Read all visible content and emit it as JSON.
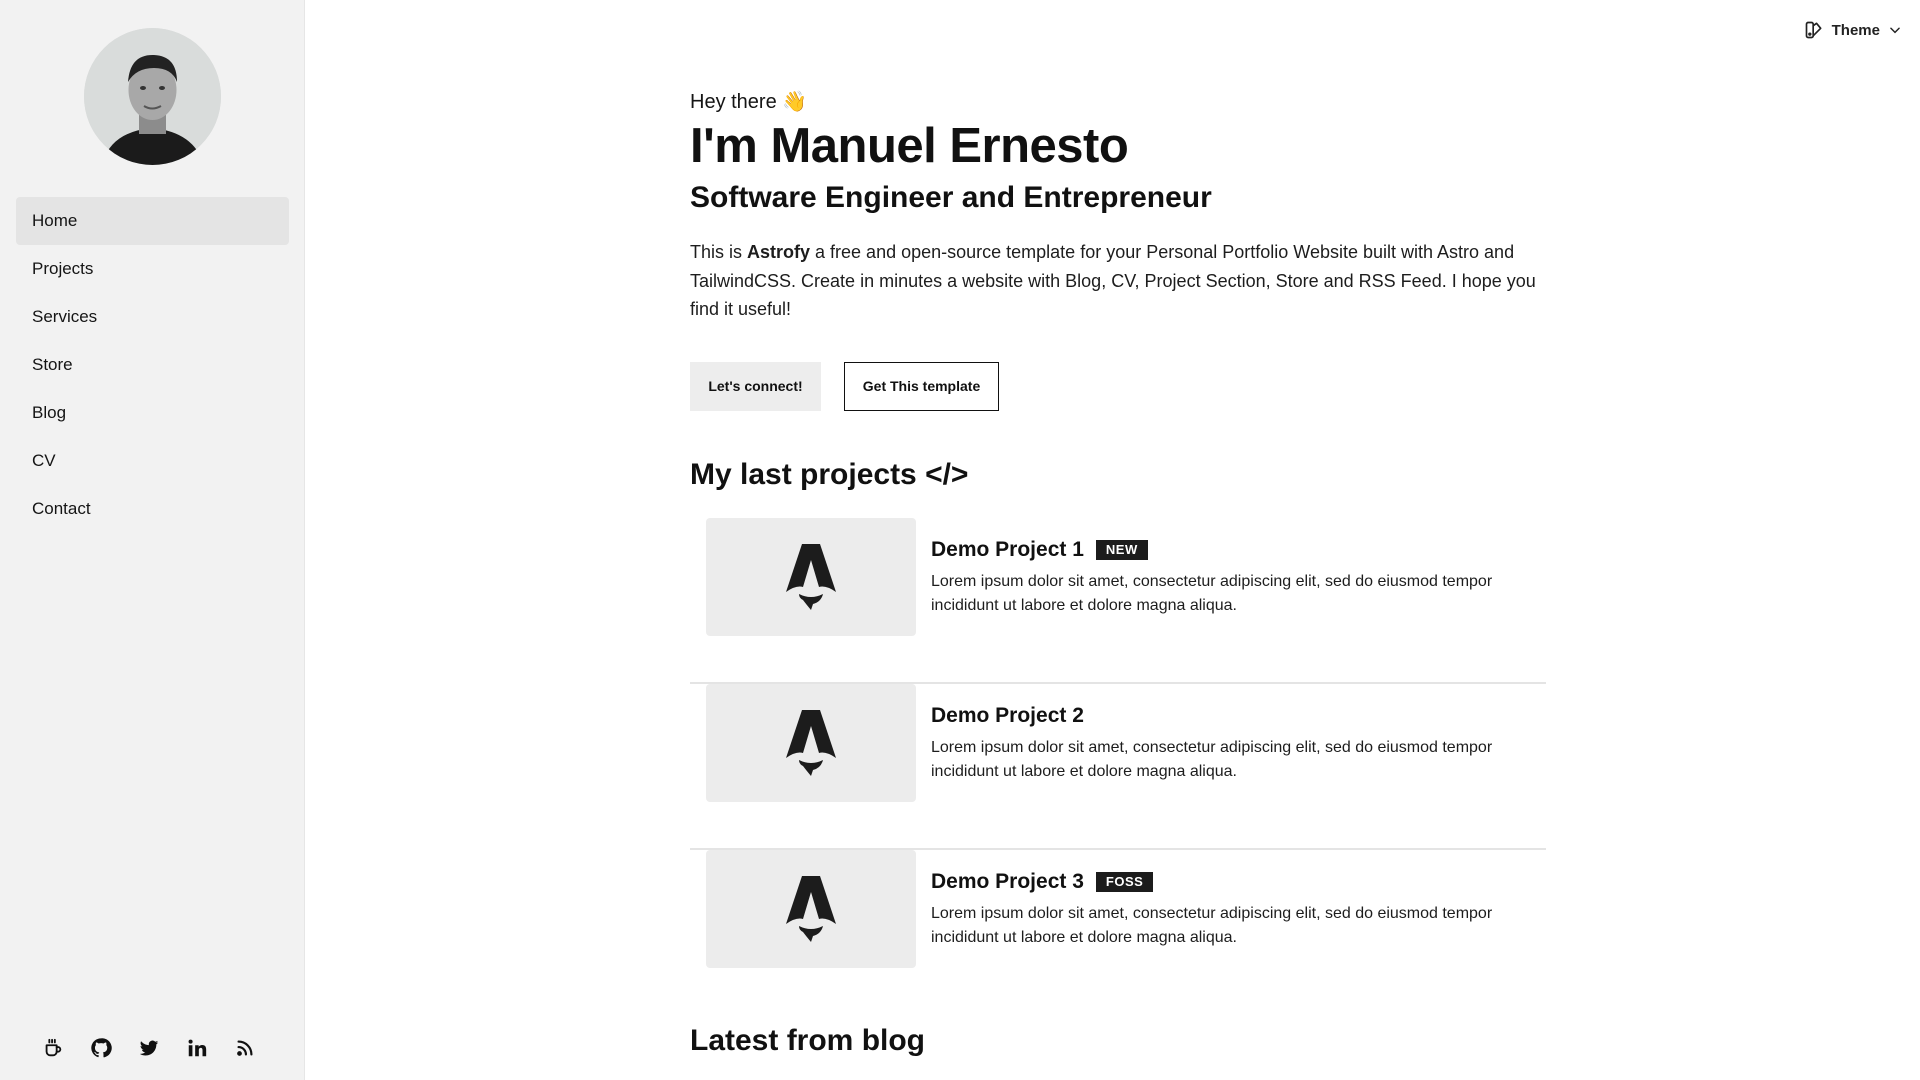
{
  "sidebar": {
    "nav": [
      {
        "label": "Home",
        "active": true
      },
      {
        "label": "Projects",
        "active": false
      },
      {
        "label": "Services",
        "active": false
      },
      {
        "label": "Store",
        "active": false
      },
      {
        "label": "Blog",
        "active": false
      },
      {
        "label": "CV",
        "active": false
      },
      {
        "label": "Contact",
        "active": false
      }
    ],
    "social": [
      "coffee-icon",
      "github-icon",
      "twitter-icon",
      "linkedin-icon",
      "rss-icon"
    ]
  },
  "header": {
    "theme_label": "Theme"
  },
  "hero": {
    "greeting": "Hey there 👋",
    "name": "I'm Manuel Ernesto",
    "subtitle": "Software Engineer and Entrepreneur",
    "intro_prefix": "This is ",
    "intro_brand": "Astrofy",
    "intro_suffix": " a free and open-source template for your Personal Portfolio Website built with Astro and TailwindCSS. Create in minutes a website with Blog, CV, Project Section, Store and RSS Feed. I hope you find it useful!",
    "connect_label": "Let's connect!",
    "template_label": "Get This template"
  },
  "projects": {
    "title": "My last projects </>",
    "items": [
      {
        "title": "Demo Project 1",
        "badge": "NEW",
        "description": "Lorem ipsum dolor sit amet, consectetur adipiscing elit, sed do eiusmod tempor incididunt ut labore et dolore magna aliqua."
      },
      {
        "title": "Demo Project 2",
        "badge": "",
        "description": "Lorem ipsum dolor sit amet, consectetur adipiscing elit, sed do eiusmod tempor incididunt ut labore et dolore magna aliqua."
      },
      {
        "title": "Demo Project 3",
        "badge": "FOSS",
        "description": "Lorem ipsum dolor sit amet, consectetur adipiscing elit, sed do eiusmod tempor incididunt ut labore et dolore magna aliqua."
      }
    ]
  },
  "blog": {
    "title": "Latest from blog"
  },
  "colors": {
    "sidebar_bg": "#f2f2f2",
    "active_item_bg": "#e4e4e4",
    "badge_bg": "#1c1c1c",
    "thumb_bg": "#ececec"
  }
}
